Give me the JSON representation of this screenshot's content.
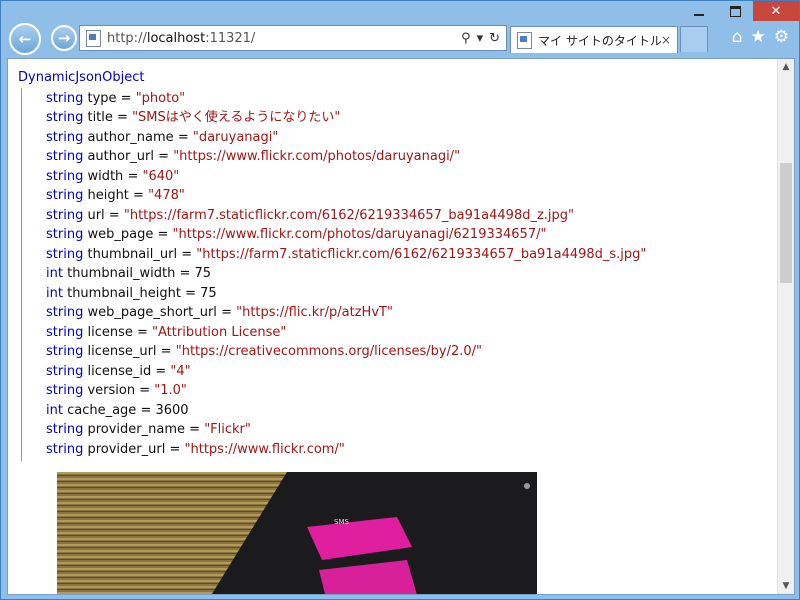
{
  "browser": {
    "url_prefix": "http://",
    "url_host": "localhost",
    "url_rest": ":11321/",
    "tab_title": "マイ サイトのタイトル",
    "tab_close": "×"
  },
  "document": {
    "object_name": "DynamicJsonObject",
    "properties": [
      {
        "type": "string",
        "name": "type",
        "value": "\"photo\""
      },
      {
        "type": "string",
        "name": "title",
        "value": "\"SMSはやく使えるようになりたい\""
      },
      {
        "type": "string",
        "name": "author_name",
        "value": "\"daruyanagi\""
      },
      {
        "type": "string",
        "name": "author_url",
        "value": "\"https://www.flickr.com/photos/daruyanagi/\""
      },
      {
        "type": "string",
        "name": "width",
        "value": "\"640\""
      },
      {
        "type": "string",
        "name": "height",
        "value": "\"478\""
      },
      {
        "type": "string",
        "name": "url",
        "value": "\"https://farm7.staticflickr.com/6162/6219334657_ba91a4498d_z.jpg\""
      },
      {
        "type": "string",
        "name": "web_page",
        "value": "\"https://www.flickr.com/photos/daruyanagi/6219334657/\""
      },
      {
        "type": "string",
        "name": "thumbnail_url",
        "value": "\"https://farm7.staticflickr.com/6162/6219334657_ba91a4498d_s.jpg\""
      },
      {
        "type": "int",
        "name": "thumbnail_width",
        "value": "75"
      },
      {
        "type": "int",
        "name": "thumbnail_height",
        "value": "75"
      },
      {
        "type": "string",
        "name": "web_page_short_url",
        "value": "\"https://flic.kr/p/atzHvT\""
      },
      {
        "type": "string",
        "name": "license",
        "value": "\"Attribution License\""
      },
      {
        "type": "string",
        "name": "license_url",
        "value": "\"https://creativecommons.org/licenses/by/2.0/\""
      },
      {
        "type": "string",
        "name": "license_id",
        "value": "\"4\""
      },
      {
        "type": "string",
        "name": "version",
        "value": "\"1.0\""
      },
      {
        "type": "int",
        "name": "cache_age",
        "value": "3600"
      },
      {
        "type": "string",
        "name": "provider_name",
        "value": "\"Flickr\""
      },
      {
        "type": "string",
        "name": "provider_url",
        "value": "\"https://www.flickr.com/\""
      }
    ],
    "photo_sms_label": "SMS"
  },
  "colors": {
    "keyword": "#0000cc",
    "string": "#a31515",
    "close_button": "#c7463d"
  },
  "icons": [
    "back-arrow-icon",
    "forward-arrow-icon",
    "page-icon",
    "search-icon",
    "refresh-icon",
    "home-icon",
    "favorites-star-icon",
    "settings-gear-icon",
    "minimize-icon",
    "maximize-icon",
    "close-icon"
  ]
}
